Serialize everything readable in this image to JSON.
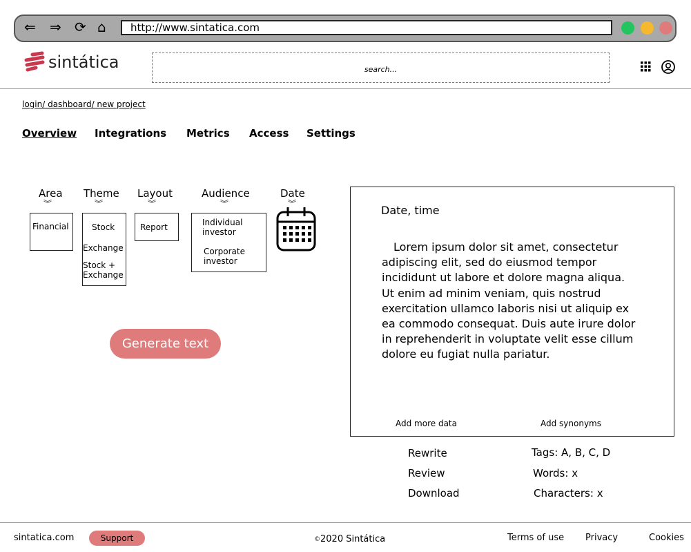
{
  "browser": {
    "url": "http://www.sintatica.com",
    "icons": [
      "back-arrow-icon",
      "forward-arrow-icon",
      "reload-icon",
      "home-icon"
    ],
    "dots": [
      "#22c55e",
      "#f5b82e",
      "#e07b7b"
    ]
  },
  "header": {
    "logo": "sintática",
    "search_placeholder": "search...",
    "icons": [
      "apps-grid-icon",
      "user-icon"
    ]
  },
  "breadcrumb": "login/ dashboard/ new project",
  "tabs": [
    "Overview",
    "Integrations",
    "Metrics",
    "Access",
    "Settings"
  ],
  "selectors": {
    "area": {
      "label": "Area",
      "options": [
        "Financial"
      ]
    },
    "theme": {
      "label": "Theme",
      "options": [
        "Stock",
        "Exchange",
        "Stock + Exchange"
      ]
    },
    "layout": {
      "label": "Layout",
      "options": [
        "Report"
      ]
    },
    "audience": {
      "label": "Audience",
      "options": [
        "Individual investor",
        "Corporate investor"
      ]
    },
    "date": {
      "label": "Date",
      "icon": "calendar-icon"
    }
  },
  "generate_label": "Generate text",
  "output": {
    "title": "Date, time",
    "body": "Lorem ipsum dolor sit amet, consectetur adipiscing elit, sed do eiusmod tempor incididunt ut labore et dolore magna aliqua. Ut enim ad minim veniam, quis nostrud exercitation ullamco laboris nisi ut aliquip ex ea commodo consequat. Duis aute irure dolor in reprehenderit in voluptate velit esse cillum dolore eu fugiat nulla pariatur.",
    "add_data": "Add more data",
    "add_synonyms": "Add synonyms"
  },
  "actions": [
    "Rewrite",
    "Review",
    "Download"
  ],
  "stats": {
    "tags": "Tags: A, B, C, D",
    "words": "Words: x",
    "characters": "Characters: x"
  },
  "footer": {
    "site": "sintatica.com",
    "support": "Support",
    "copyright": "2020 Sintática",
    "terms": "Terms of use",
    "privacy": "Privacy",
    "cookies": "Cookies"
  },
  "colors": {
    "accent": "#e07b7b",
    "logo": "#c8384e"
  }
}
